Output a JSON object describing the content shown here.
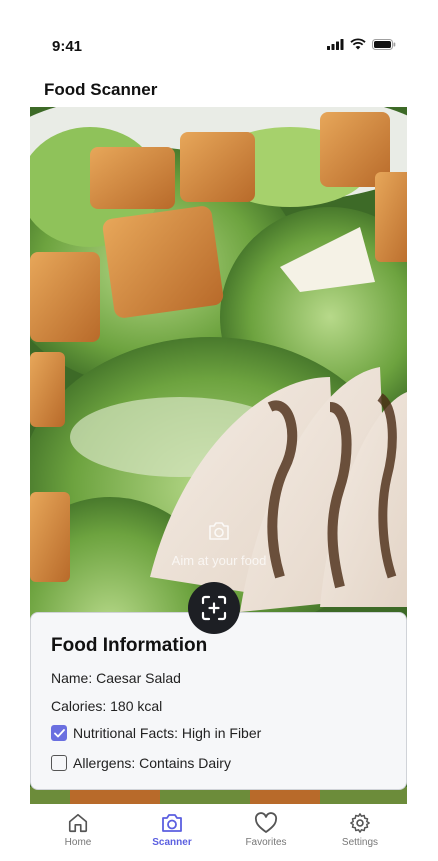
{
  "status_bar": {
    "time": "9:41"
  },
  "app": {
    "title": "Food Scanner"
  },
  "camera": {
    "hint": "Aim at your food"
  },
  "info": {
    "title": "Food Information",
    "name": "Name: Caesar Salad",
    "calories": "Calories: 180 kcal",
    "checks": [
      {
        "label": "Nutritional Facts: High in Fiber",
        "checked": true
      },
      {
        "label": "Allergens: Contains Dairy",
        "checked": false
      }
    ]
  },
  "tabs": [
    {
      "label": "Home",
      "icon": "home-icon"
    },
    {
      "label": "Scanner",
      "icon": "camera-icon",
      "active": true
    },
    {
      "label": "Favorites",
      "icon": "heart-icon"
    },
    {
      "label": "Settings",
      "icon": "gear-icon"
    }
  ],
  "colors": {
    "accent": "#5b5fe0",
    "scan_button": "#1d1f24"
  }
}
